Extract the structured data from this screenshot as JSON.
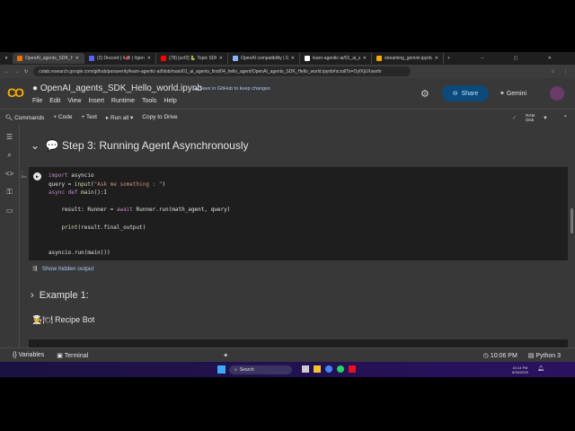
{
  "browser": {
    "tabs": [
      {
        "label": "OpenAI_agents_SDK_Hello_wo",
        "color": "#e8710a",
        "active": true
      },
      {
        "label": "(2) Discord | #📣 | #general",
        "color": "#5865f2"
      },
      {
        "label": "(78) [ucf2] 🐍 Topic SDK_Run",
        "color": "#ff0000"
      },
      {
        "label": "OpenAI compatibility | Gemini",
        "color": "#8ab4f8"
      },
      {
        "label": "learn-agentic-ai/01_ai_agents",
        "color": "#ffffff"
      },
      {
        "label": "streaming_gemini.ipynb - Colab",
        "color": "#f9ab00"
      }
    ],
    "url": "colab.research.google.com/github/panaverity/learn-agentic-ai/blob/main/01_ai_agents_first/04_hello_agent/OpenAI_agents_SDK_Hello_world.ipynb#scrollTo=OyfXjUXswrhr"
  },
  "header": {
    "title": "OpenAI_agents_SDK_Hello_world.ipynb",
    "save_notice": "Save in GitHub to keep changes",
    "share": "Share",
    "gemini": "Gemini",
    "menu": [
      "File",
      "Edit",
      "View",
      "Insert",
      "Runtime",
      "Tools",
      "Help"
    ]
  },
  "toolbar": {
    "commands": "Commands",
    "code": "+ Code",
    "text": "+ Text",
    "run_all": "Run all",
    "copy": "Copy to Drive",
    "ram": "RAM",
    "disk": "Disk"
  },
  "notebook": {
    "step3": "Step 3: Running Agent Asynchronously",
    "exec_time": "16s",
    "show_hidden": "Show hidden output",
    "example1": "Example 1:",
    "recipe": "Recipe Bot"
  },
  "status": {
    "variables": "Variables",
    "terminal": "Terminal",
    "time": "10:06 PM",
    "runtime": "Python 3"
  },
  "taskbar": {
    "search": "Search",
    "clock_time": "10:14 PM",
    "clock_date": "8/26/2025"
  }
}
